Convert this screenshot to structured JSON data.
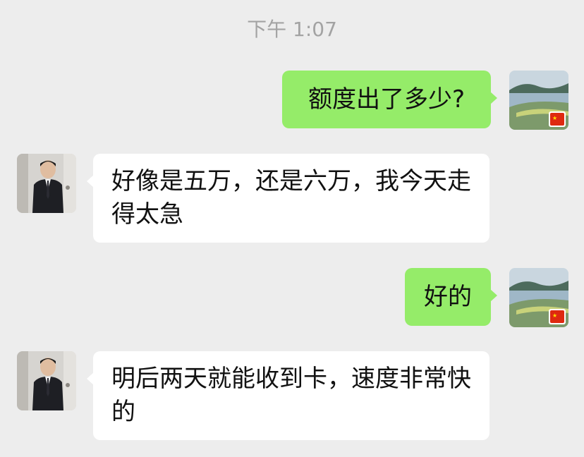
{
  "timestamp": "下午 1:07",
  "messages": [
    {
      "side": "out",
      "text": "额度出了多少?",
      "avatar": "self-avatar"
    },
    {
      "side": "in",
      "text": "好像是五万，还是六万，我今天走得太急",
      "avatar": "contact-avatar"
    },
    {
      "side": "out",
      "text": "好的",
      "avatar": "self-avatar"
    },
    {
      "side": "in",
      "text": "明后两天就能收到卡，速度非常快的",
      "avatar": "contact-avatar"
    }
  ],
  "colors": {
    "background": "#ededed",
    "outgoing_bubble": "#95ec69",
    "incoming_bubble": "#ffffff",
    "timestamp_text": "#a3a3a3"
  }
}
